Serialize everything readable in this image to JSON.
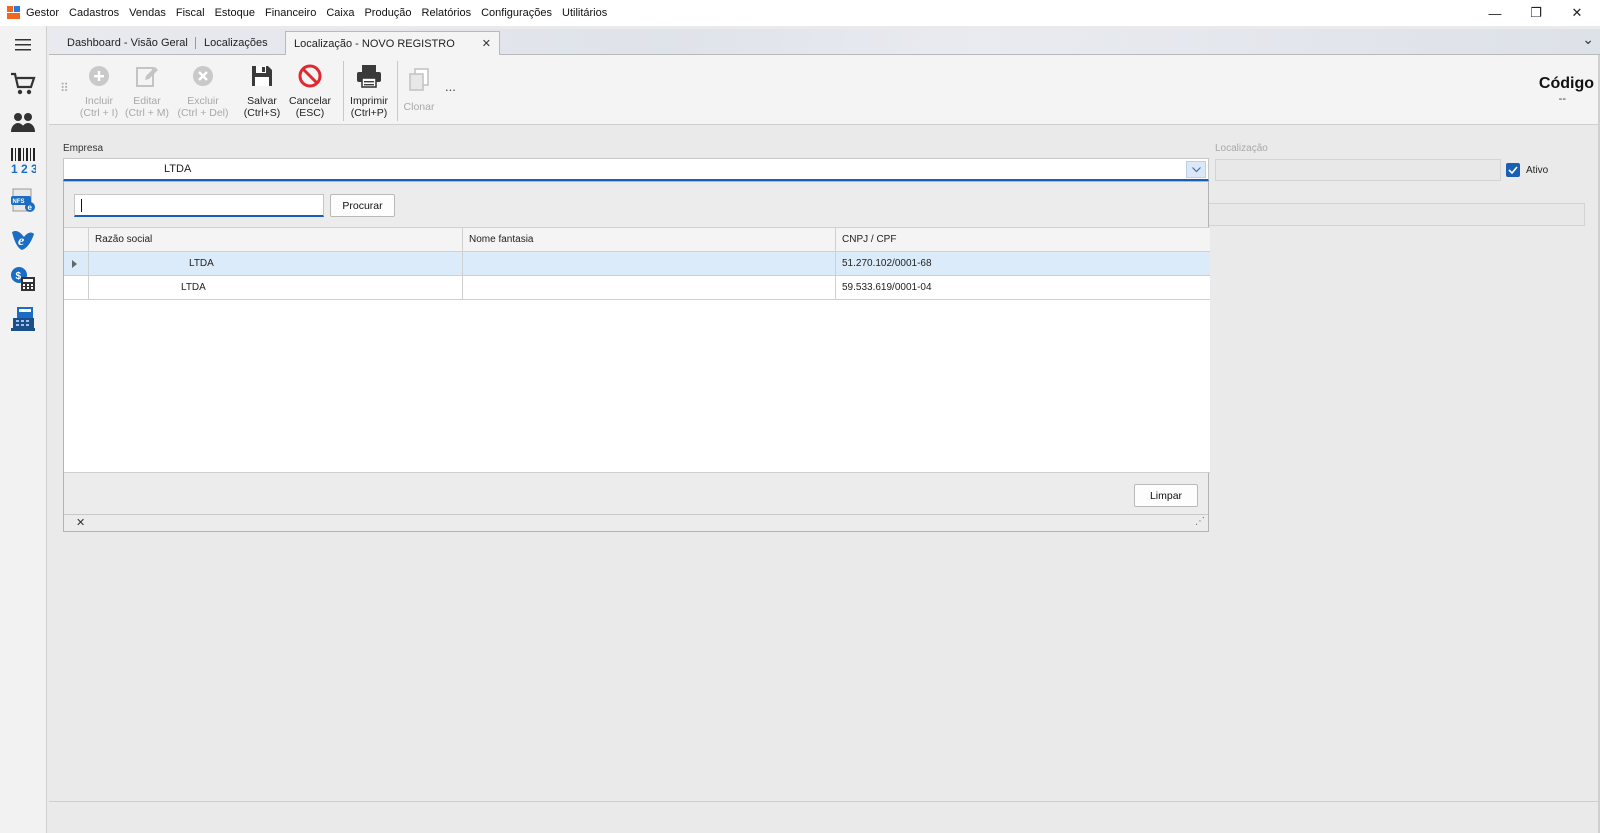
{
  "menu": {
    "items": [
      "Gestor",
      "Cadastros",
      "Vendas",
      "Fiscal",
      "Estoque",
      "Financeiro",
      "Caixa",
      "Produção",
      "Relatórios",
      "Configurações",
      "Utilitários"
    ]
  },
  "window_controls": {
    "minimize": "—",
    "restore": "❐",
    "close": "✕"
  },
  "rail": {
    "menu_icon": "hamburger-icon",
    "items": [
      "cart-icon",
      "people-icon",
      "barcode-icon",
      "nfse-icon",
      "nfe-icon",
      "calculator-icon",
      "cash-register-icon"
    ]
  },
  "tabs": [
    {
      "label": "Dashboard - Visão Geral"
    },
    {
      "label": "Localizações"
    },
    {
      "label": "Localização - NOVO REGISTRO",
      "active": true,
      "close": "✕"
    }
  ],
  "tab_overflow": "⌄",
  "toolbar": {
    "incluir": {
      "label": "Incluir",
      "shortcut": "(Ctrl + I)"
    },
    "editar": {
      "label": "Editar",
      "shortcut": "(Ctrl + M)"
    },
    "excluir": {
      "label": "Excluir",
      "shortcut": "(Ctrl + Del)"
    },
    "salvar": {
      "label": "Salvar",
      "shortcut": "(Ctrl+S)"
    },
    "cancelar": {
      "label": "Cancelar",
      "shortcut": "(ESC)"
    },
    "imprimir": {
      "label": "Imprimir",
      "shortcut": "(Ctrl+P)"
    },
    "clonar": {
      "label": "Clonar"
    },
    "more": "...",
    "grip": "⠿"
  },
  "header": {
    "codigo_title": "Código",
    "codigo_value": "--"
  },
  "form": {
    "empresa_label": "Empresa",
    "empresa_value": "LTDA",
    "localizacao_label": "Localização",
    "ativo_label": "Ativo",
    "ativo_checked": true
  },
  "popup": {
    "search_value": "",
    "search_button": "Procurar",
    "columns": [
      "Razão social",
      "Nome fantasia",
      "CNPJ / CPF"
    ],
    "rows": [
      {
        "razao_social": "LTDA",
        "nome_fantasia": "",
        "cnpj": "51.270.102/0001-68",
        "selected": true
      },
      {
        "razao_social": "LTDA",
        "nome_fantasia": "",
        "cnpj": "59.533.619/0001-04",
        "selected": false
      }
    ],
    "clear_button": "Limpar",
    "close_glyph": "✕",
    "resize_glyph": "⋰"
  },
  "colors": {
    "accent": "#1a5fb4",
    "cancel_red": "#e0282e",
    "selection": "#dcebfa"
  }
}
